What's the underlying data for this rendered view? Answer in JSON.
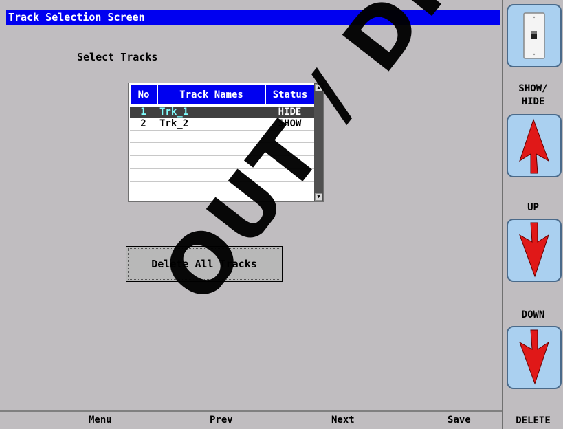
{
  "window": {
    "title": "Track Selection Screen"
  },
  "main": {
    "select_label": "Select Tracks",
    "delete_all_label": "Delete All Tracks"
  },
  "table": {
    "columns": [
      "No",
      "Track Names",
      "Status"
    ],
    "rows": [
      {
        "no": "1",
        "name": "Trk_1",
        "status": "HIDE",
        "selected": true
      },
      {
        "no": "2",
        "name": "Trk_2",
        "status": "SHOW",
        "selected": false
      }
    ]
  },
  "bottom_bar": {
    "menu": "Menu",
    "prev": "Prev",
    "next": "Next",
    "save": "Save"
  },
  "side_panel": {
    "show_hide_label": "SHOW/\nHIDE",
    "up_label": "UP",
    "down_label": "DOWN",
    "delete_label": "DELETE"
  },
  "watermark": {
    "text": "OUT / DISCO Ava"
  },
  "colors": {
    "title_bar": "#0000f0",
    "selected_row_bg": "#404040",
    "selected_text": "#80ffff",
    "arrow_red": "#e01818",
    "tile_bg": "#aad0f0"
  }
}
